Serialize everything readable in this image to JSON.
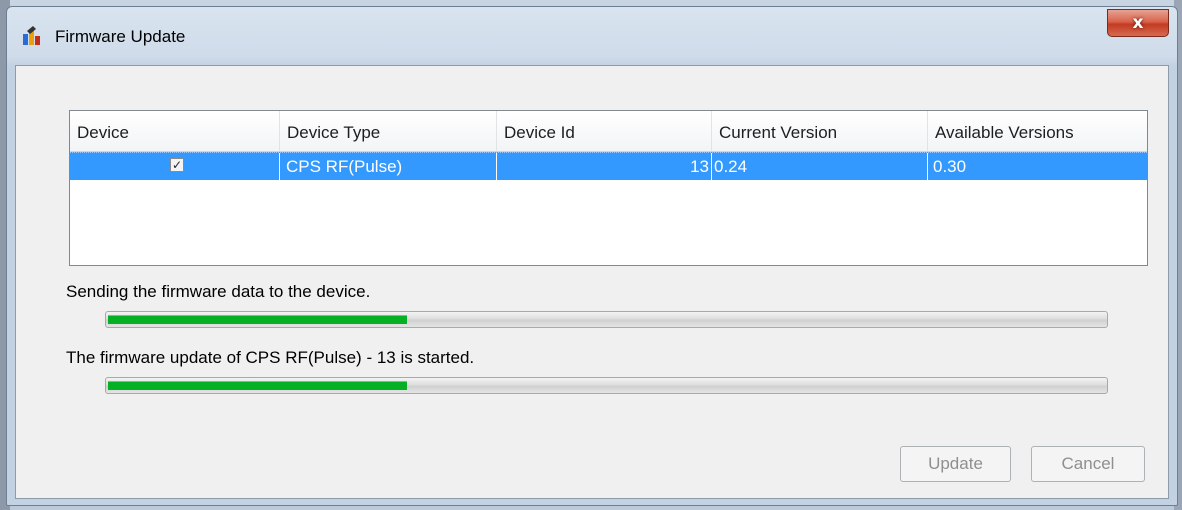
{
  "window": {
    "title": "Firmware Update",
    "close_glyph": "x",
    "icon": "firmware-app-icon"
  },
  "table": {
    "columns": [
      "Device",
      "Device Type",
      "Device Id",
      "Current Version",
      "Available Versions"
    ],
    "rows": [
      {
        "device_checked": true,
        "checkbox_glyph": "✓",
        "device_type": "CPS RF(Pulse)",
        "device_id": "13",
        "current_version": "0.24",
        "available_versions": "0.30"
      }
    ]
  },
  "progress": [
    {
      "label": "Sending the firmware data to the device.",
      "value": 0.3
    },
    {
      "label": "The firmware update of CPS RF(Pulse) - 13 is started.",
      "value": 0.3
    }
  ],
  "buttons": {
    "update": "Update",
    "cancel": "Cancel"
  },
  "colors": {
    "selection": "#3399ff",
    "progress": "#06b025",
    "close": "#c23b22"
  }
}
